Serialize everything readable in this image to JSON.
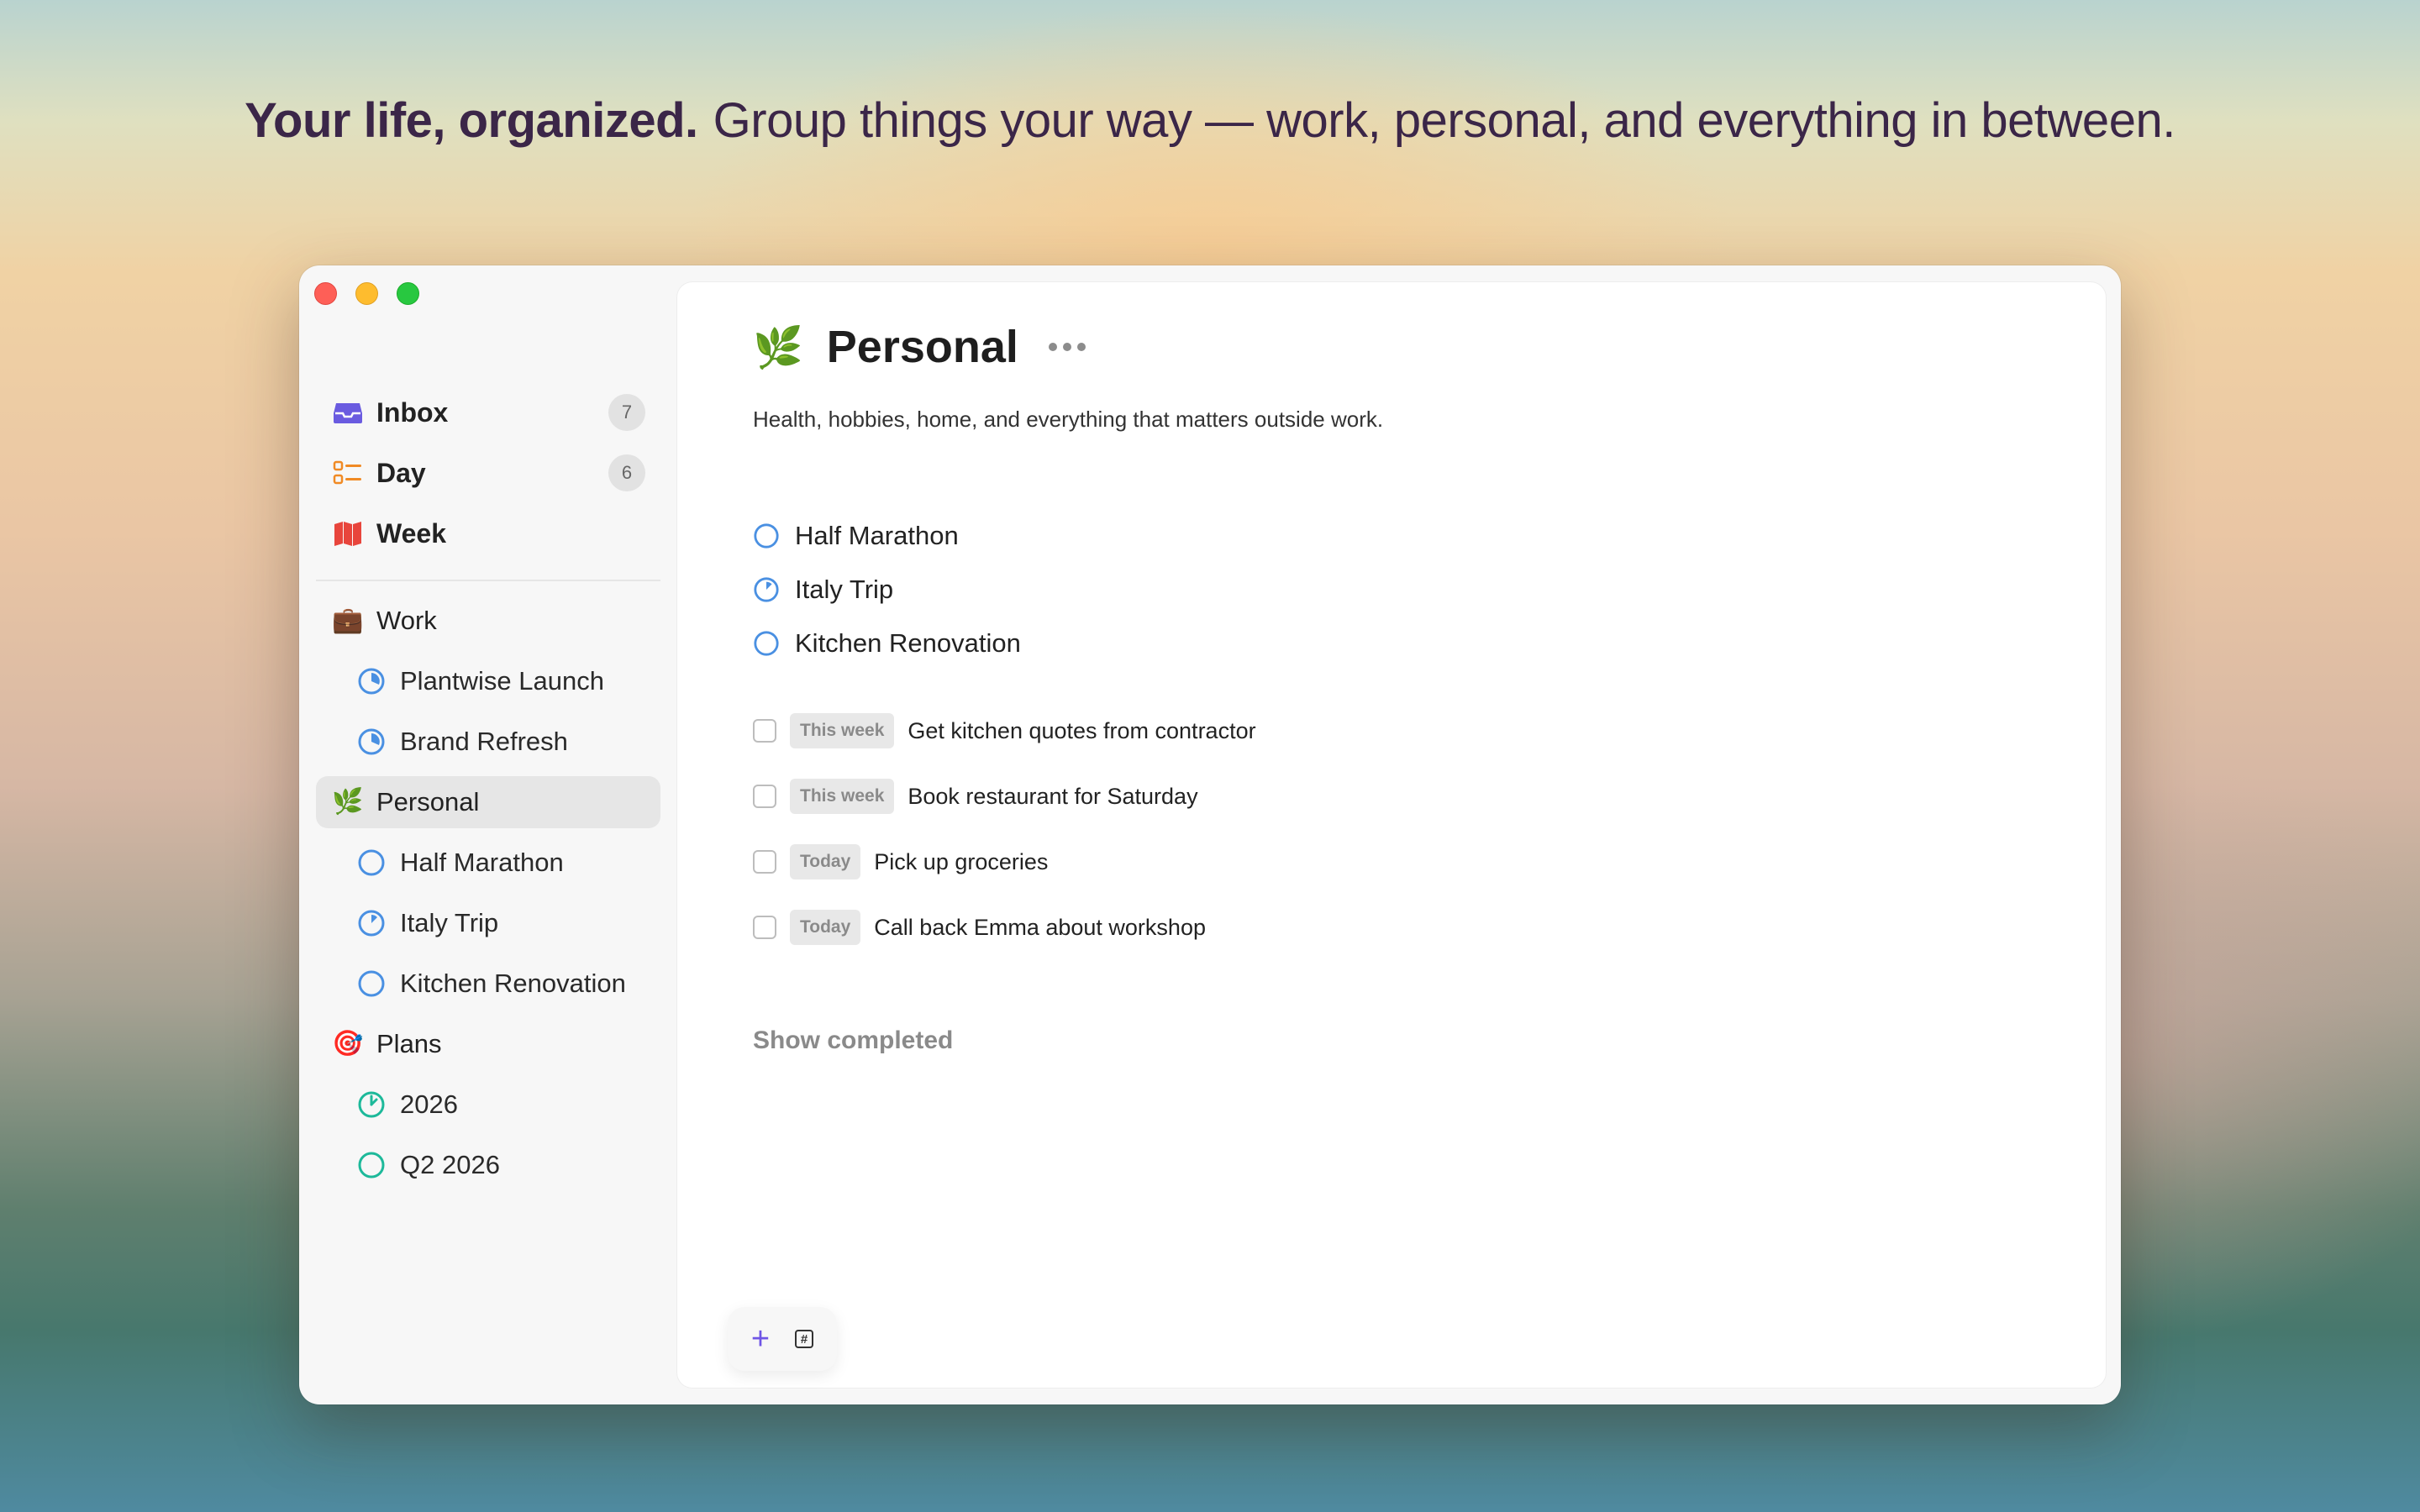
{
  "headline": {
    "bold": "Your life, organized.",
    "rest": "Group things your way — work, personal, and everything in between."
  },
  "colors": {
    "accent_purple": "#6f55e5",
    "project_blue": "#4a90e2",
    "project_teal": "#1db99a",
    "day_orange": "#f08a24",
    "week_red": "#e8453c"
  },
  "sidebar": {
    "top_items": [
      {
        "label": "Inbox",
        "icon": "inbox-icon",
        "count": "7"
      },
      {
        "label": "Day",
        "icon": "list-icon",
        "count": "6"
      },
      {
        "label": "Week",
        "icon": "map-icon",
        "count": ""
      }
    ],
    "groups": [
      {
        "label": "Work",
        "icon": "💼",
        "children": [
          "Plantwise Launch",
          "Brand Refresh"
        ]
      },
      {
        "label": "Personal",
        "icon": "🌿",
        "selected": true,
        "children": [
          "Half Marathon",
          "Italy Trip",
          "Kitchen Renovation"
        ]
      },
      {
        "label": "Plans",
        "icon": "🎯",
        "children": [
          "2026",
          "Q2 2026"
        ]
      }
    ]
  },
  "main": {
    "icon": "🌿",
    "title": "Personal",
    "description": "Health, hobbies, home, and everything that matters outside work.",
    "projects": [
      "Half Marathon",
      "Italy Trip",
      "Kitchen Renovation"
    ],
    "tasks": [
      {
        "tag": "This week",
        "label": "Get kitchen quotes from contractor"
      },
      {
        "tag": "This week",
        "label": "Book restaurant for Saturday"
      },
      {
        "tag": "Today",
        "label": "Pick up groceries"
      },
      {
        "tag": "Today",
        "label": "Call back Emma about workshop"
      }
    ],
    "show_completed": "Show completed"
  },
  "bottom_bar": {
    "add_icon": "+",
    "tag_icon": "#"
  }
}
